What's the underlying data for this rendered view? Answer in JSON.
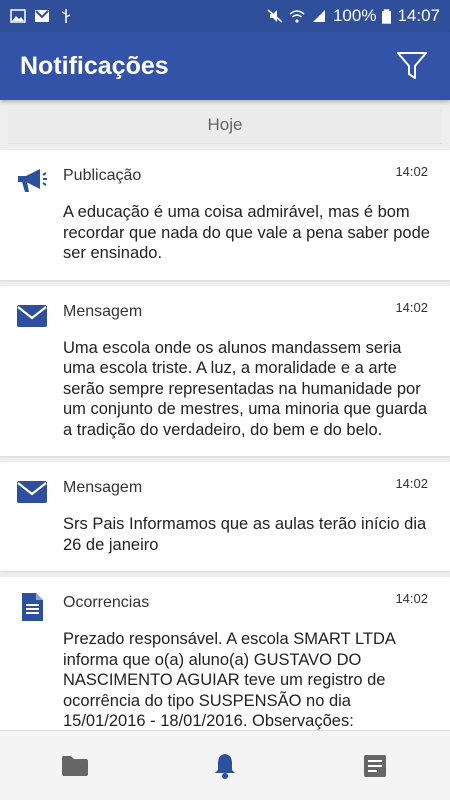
{
  "statusbar": {
    "battery": "100%",
    "time": "14:07"
  },
  "appbar": {
    "title": "Notificações"
  },
  "section": {
    "label": "Hoje"
  },
  "notifications": [
    {
      "type": "Publicação",
      "icon": "megaphone-icon",
      "time": "14:02",
      "text": "A educação é uma coisa admirável, mas é bom recordar que nada do que vale a pena saber pode ser ensinado."
    },
    {
      "type": "Mensagem",
      "icon": "envelope-icon",
      "time": "14:02",
      "text": "Uma escola onde os alunos mandassem seria uma escola triste. A luz, a moralidade e a arte serão sempre representadas na humanidade por um conjunto de mestres, uma minoria que guarda a tradição do verdadeiro, do bem e do belo."
    },
    {
      "type": "Mensagem",
      "icon": "envelope-icon",
      "time": "14:02",
      "text": "Srs Pais Informamos que as aulas terão início dia 26 de janeiro"
    },
    {
      "type": "Ocorrencias",
      "icon": "document-icon",
      "time": "14:02",
      "text": "Prezado responsável. A escola SMART LTDA informa que o(a) aluno(a) GUSTAVO DO NASCIMENTO AGUIAR teve um registro de ocorrência do tipo SUSPENSÃO no dia 15/01/2016 - 18/01/2016. Observações:"
    }
  ],
  "bottomnav": {
    "items": [
      "folder-icon",
      "bell-icon",
      "notes-icon"
    ],
    "active": "bell-icon"
  },
  "colors": {
    "primary": "#3353a8",
    "statusbar": "#2f4f9a",
    "icon_blue": "#2d4fa0",
    "nav_gray": "#666666"
  }
}
